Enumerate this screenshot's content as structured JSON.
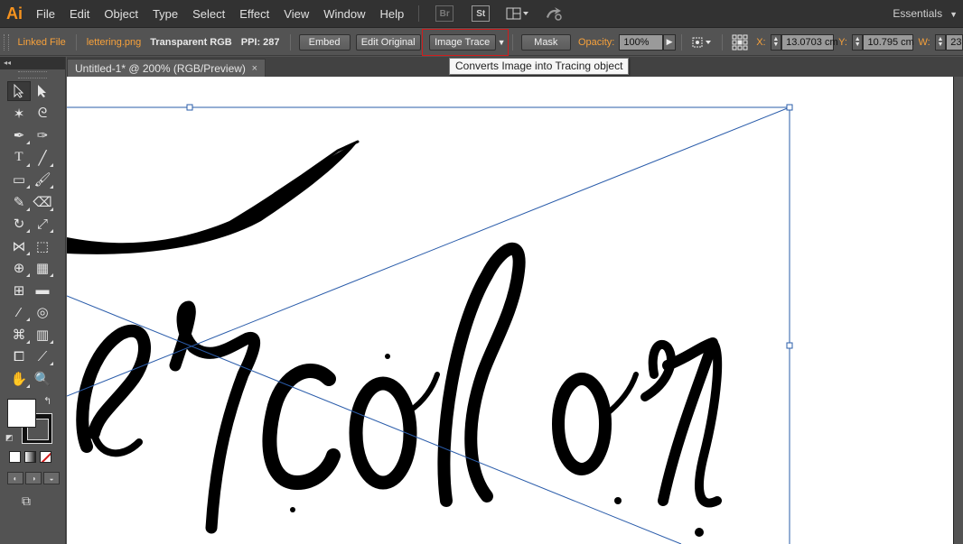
{
  "app": {
    "logo": "Ai",
    "menu": [
      "File",
      "Edit",
      "Object",
      "Type",
      "Select",
      "Effect",
      "View",
      "Window",
      "Help"
    ],
    "bridge_label": "Br",
    "stock_label": "St",
    "workspace": "Essentials"
  },
  "control_bar": {
    "object_type": "Linked File",
    "file_name": "lettering.png",
    "color_mode": "Transparent RGB",
    "ppi": "PPI: 287",
    "embed_label": "Embed",
    "edit_original_label": "Edit Original",
    "image_trace_label": "Image Trace",
    "mask_label": "Mask",
    "opacity_label": "Opacity:",
    "opacity_value": "100%",
    "x_label": "X:",
    "x_value": "13.0703 cm",
    "y_label": "Y:",
    "y_value": "10.795 cm",
    "w_label": "W:",
    "w_value": "23."
  },
  "tooltip": "Converts Image into Tracing object",
  "document": {
    "tab_title": "Untitled-1* @ 200% (RGB/Preview)",
    "close_glyph": "×"
  },
  "tools_panel": {
    "collapse_glyph": "◂◂"
  },
  "highlight_color": "#d11b1b",
  "selection_color": "#2a5caa"
}
